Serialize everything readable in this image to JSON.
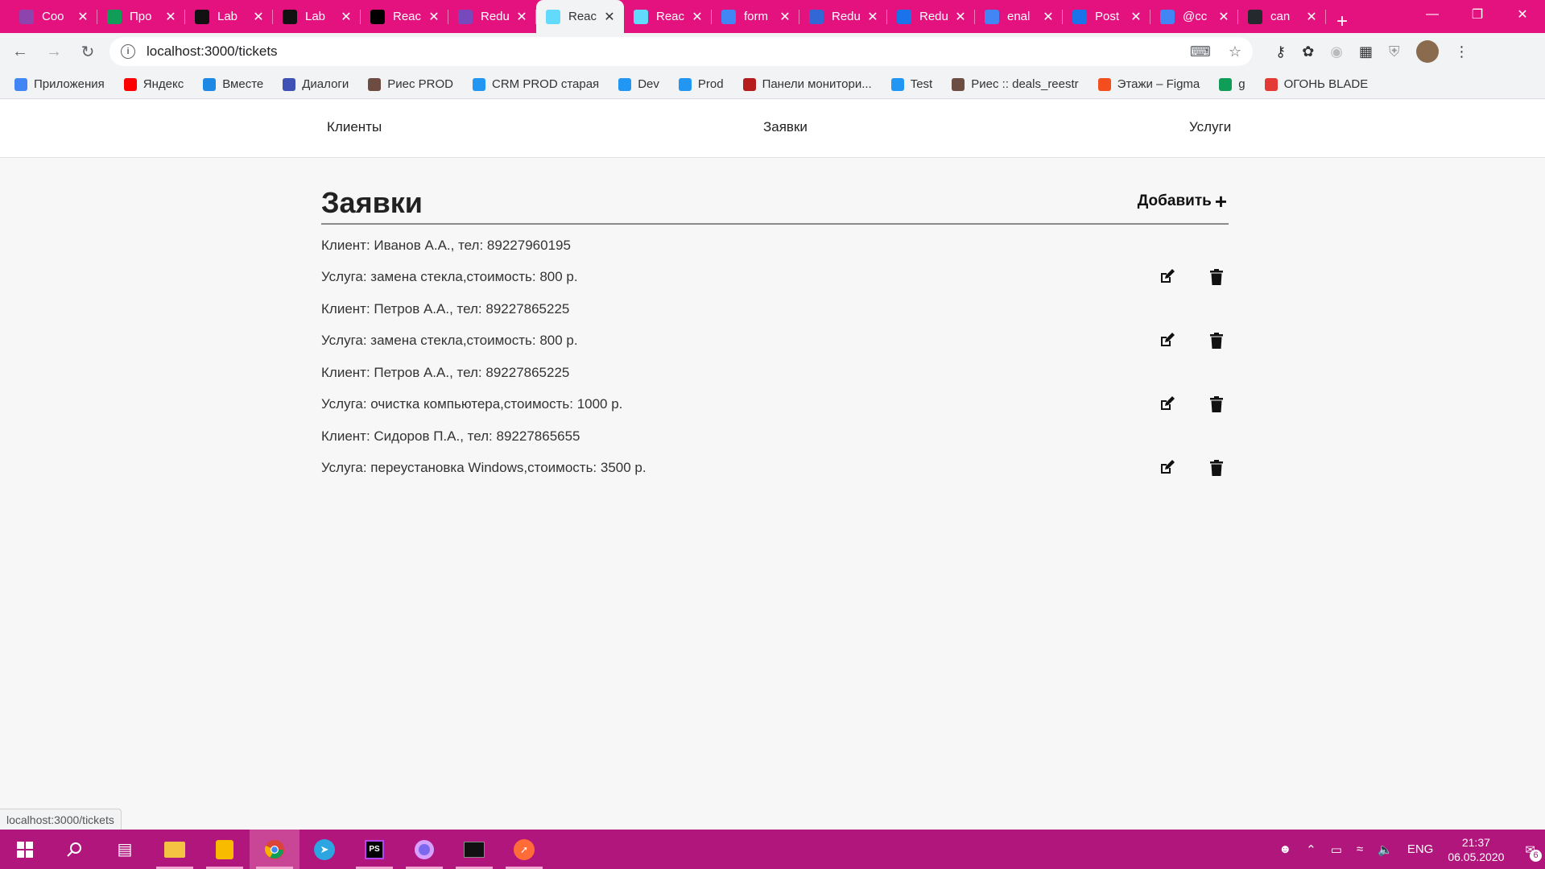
{
  "browser": {
    "tabs": [
      {
        "title": "Coo",
        "favicon_color": "#8e44ad",
        "favicon_icon": "chat-bubble-icon",
        "active": false
      },
      {
        "title": "Про",
        "favicon_color": "#0f9d58",
        "favicon_icon": "sheets-plus-icon",
        "active": false
      },
      {
        "title": "Lab",
        "favicon_color": "#111111",
        "favicon_icon": "lab-logo-icon",
        "active": false
      },
      {
        "title": "Lab",
        "favicon_color": "#111111",
        "favicon_icon": "lab-logo-icon",
        "active": false
      },
      {
        "title": "Reac",
        "favicon_color": "#000000",
        "favicon_icon": "medium-m-icon",
        "active": false
      },
      {
        "title": "Redu",
        "favicon_color": "#764abc",
        "favicon_icon": "redux-icon",
        "active": false
      },
      {
        "title": "Reac",
        "favicon_color": "#61dafb",
        "favicon_icon": "react-icon",
        "active": true
      },
      {
        "title": "Reac",
        "favicon_color": "#61dafb",
        "favicon_icon": "react-icon",
        "active": false
      },
      {
        "title": "form",
        "favicon_color": "#4285f4",
        "favicon_icon": "google-g-icon",
        "active": false
      },
      {
        "title": "Redu",
        "favicon_color": "#3367d6",
        "favicon_icon": "translate-icon",
        "active": false
      },
      {
        "title": "Redu",
        "favicon_color": "#1a73e8",
        "favicon_icon": "square-o-icon",
        "active": false
      },
      {
        "title": "enal",
        "favicon_color": "#4285f4",
        "favicon_icon": "google-g-icon",
        "active": false
      },
      {
        "title": "Post",
        "favicon_color": "#1a73e8",
        "favicon_icon": "question-icon",
        "active": false
      },
      {
        "title": "@cc",
        "favicon_color": "#4285f4",
        "favicon_icon": "google-g-icon",
        "active": false
      },
      {
        "title": "can",
        "favicon_color": "#24292e",
        "favicon_icon": "github-icon",
        "active": false
      }
    ],
    "url": "localhost:3000/tickets",
    "bookmarks": [
      {
        "label": "Приложения",
        "icon": "apps-grid-icon",
        "color": "#4285f4"
      },
      {
        "label": "Яндекс",
        "icon": "yandex-icon",
        "color": "#ff0000"
      },
      {
        "label": "Вместе",
        "icon": "vmeste-icon",
        "color": "#1e88e5"
      },
      {
        "label": "Диалоги",
        "icon": "chat-icon",
        "color": "#3f51b5"
      },
      {
        "label": "Риес  PROD",
        "icon": "ries-icon",
        "color": "#6d4c41"
      },
      {
        "label": "CRM PROD старая",
        "icon": "cube-icon",
        "color": "#2196f3"
      },
      {
        "label": "Dev",
        "icon": "cube-icon",
        "color": "#2196f3"
      },
      {
        "label": "Prod",
        "icon": "cube-icon",
        "color": "#2196f3"
      },
      {
        "label": "Панели монитори...",
        "icon": "grafana-icon",
        "color": "#b71c1c"
      },
      {
        "label": "Test",
        "icon": "cube-icon",
        "color": "#2196f3"
      },
      {
        "label": "Риес :: deals_reestr",
        "icon": "ries-icon",
        "color": "#6d4c41"
      },
      {
        "label": "Этажи – Figma",
        "icon": "figma-icon",
        "color": "#f24e1e"
      },
      {
        "label": "g",
        "icon": "sheets-plus-icon",
        "color": "#0f9d58"
      },
      {
        "label": "ОГОНЬ BLADE",
        "icon": "fire-icon",
        "color": "#e53935"
      }
    ],
    "status_url": "localhost:3000/tickets"
  },
  "app": {
    "nav": {
      "clients": "Клиенты",
      "tickets": "Заявки",
      "services": "Услуги"
    },
    "title": "Заявки",
    "add_label": "Добавить",
    "tickets": [
      {
        "client": "Клиент: Иванов А.А., тел: 89227960195",
        "service": "Услуга: замена стекла,стоимость: 800 р."
      },
      {
        "client": "Клиент: Петров А.А., тел: 89227865225",
        "service": "Услуга: замена стекла,стоимость: 800 р."
      },
      {
        "client": "Клиент: Петров А.А., тел: 89227865225",
        "service": "Услуга: очистка компьютера,стоимость: 1000 р."
      },
      {
        "client": "Клиент: Сидоров П.А., тел: 89227865655",
        "service": "Услуга: переустановка Windows,стоимость: 3500 р."
      }
    ]
  },
  "taskbar": {
    "lang": "ENG",
    "time": "21:37",
    "date": "06.05.2020",
    "notifications": "6"
  },
  "colors": {
    "accent": "#e3127f",
    "taskbar": "#b0167c"
  }
}
